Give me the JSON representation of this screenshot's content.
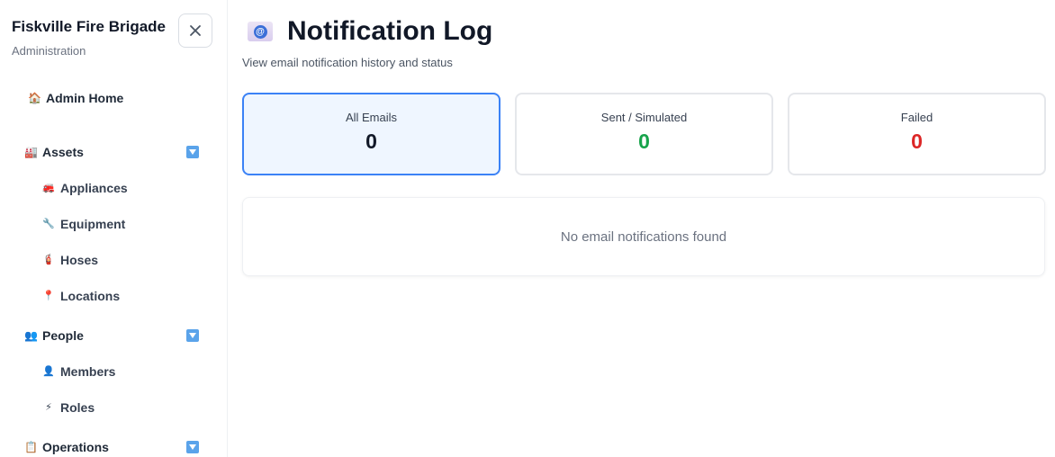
{
  "sidebar": {
    "brand_title": "Fiskville Fire Brigade",
    "brand_subtitle": "Administration",
    "close_label": "✕",
    "home": {
      "icon": "🏠",
      "label": "Admin Home"
    },
    "groups": [
      {
        "icon": "🏭",
        "label": "Assets",
        "expanded": true,
        "items": [
          {
            "icon": "🚒",
            "label": "Appliances"
          },
          {
            "icon": "🔧",
            "label": "Equipment"
          },
          {
            "icon": "🧯",
            "label": "Hoses"
          },
          {
            "icon": "📍",
            "label": "Locations"
          }
        ]
      },
      {
        "icon": "👥",
        "label": "People",
        "expanded": true,
        "items": [
          {
            "icon": "👤",
            "label": "Members"
          },
          {
            "icon": "⚡",
            "label": "Roles"
          }
        ]
      },
      {
        "icon": "📋",
        "label": "Operations",
        "expanded": true,
        "items": []
      }
    ]
  },
  "header": {
    "icon": "@",
    "title": "Notification Log",
    "subtitle": "View email notification history and status"
  },
  "stats": [
    {
      "label": "All Emails",
      "value": "0",
      "color": "#111827",
      "active": true
    },
    {
      "label": "Sent / Simulated",
      "value": "0",
      "color": "#16a34a",
      "active": false
    },
    {
      "label": "Failed",
      "value": "0",
      "color": "#dc2626",
      "active": false
    }
  ],
  "empty_message": "No email notifications found",
  "colors": {
    "accent": "#3b82f6",
    "toggle": "#5aa3ea",
    "success": "#16a34a",
    "danger": "#dc2626"
  }
}
